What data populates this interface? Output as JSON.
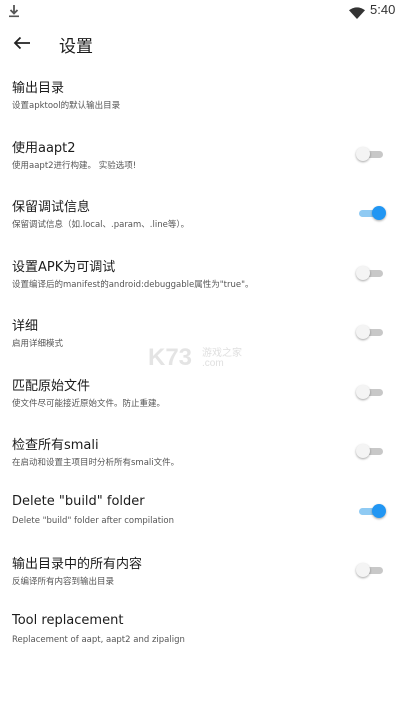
{
  "status_bar": {
    "time": "5:40",
    "icons": [
      "download-icon",
      "wifi-icon"
    ]
  },
  "app_bar": {
    "title": "设置",
    "back_icon": "arrow-left-icon"
  },
  "settings": [
    {
      "title": "输出目录",
      "summary": "设置apktool的默认输出目录"
    },
    {
      "title": "使用aapt2",
      "summary": "使用aapt2进行构建。 实验选项!",
      "toggle": false
    },
    {
      "title": "保留调试信息",
      "summary": "保留调试信息（如.local、.param、.line等）。",
      "toggle": true
    },
    {
      "title": "设置APK为可调试",
      "summary": "设置编译后的manifest的android:debuggable属性为\"true\"。",
      "toggle": false
    },
    {
      "title": "详细",
      "summary": "启用详细模式",
      "toggle": false
    },
    {
      "title": "匹配原始文件",
      "summary": "使文件尽可能接近原始文件。防止重建。",
      "toggle": false
    },
    {
      "title": "检查所有smali",
      "summary": "在启动和设置主项目时分析所有smali文件。",
      "toggle": false
    },
    {
      "title": "Delete \"build\" folder",
      "summary": "Delete \"build\" folder after compilation",
      "toggle": true
    },
    {
      "title": "输出目录中的所有内容",
      "summary": "反编译所有内容到输出目录",
      "toggle": false
    },
    {
      "title": "Tool replacement",
      "summary": "Replacement of aapt, aapt2 and zipalign"
    }
  ],
  "watermark": {
    "logo": "K73",
    "text": "游戏之家",
    "url": ".com"
  },
  "colors": {
    "accent": "#2196f3",
    "accent_track": "#8fcaf3",
    "off_track": "#c8c8c8"
  }
}
